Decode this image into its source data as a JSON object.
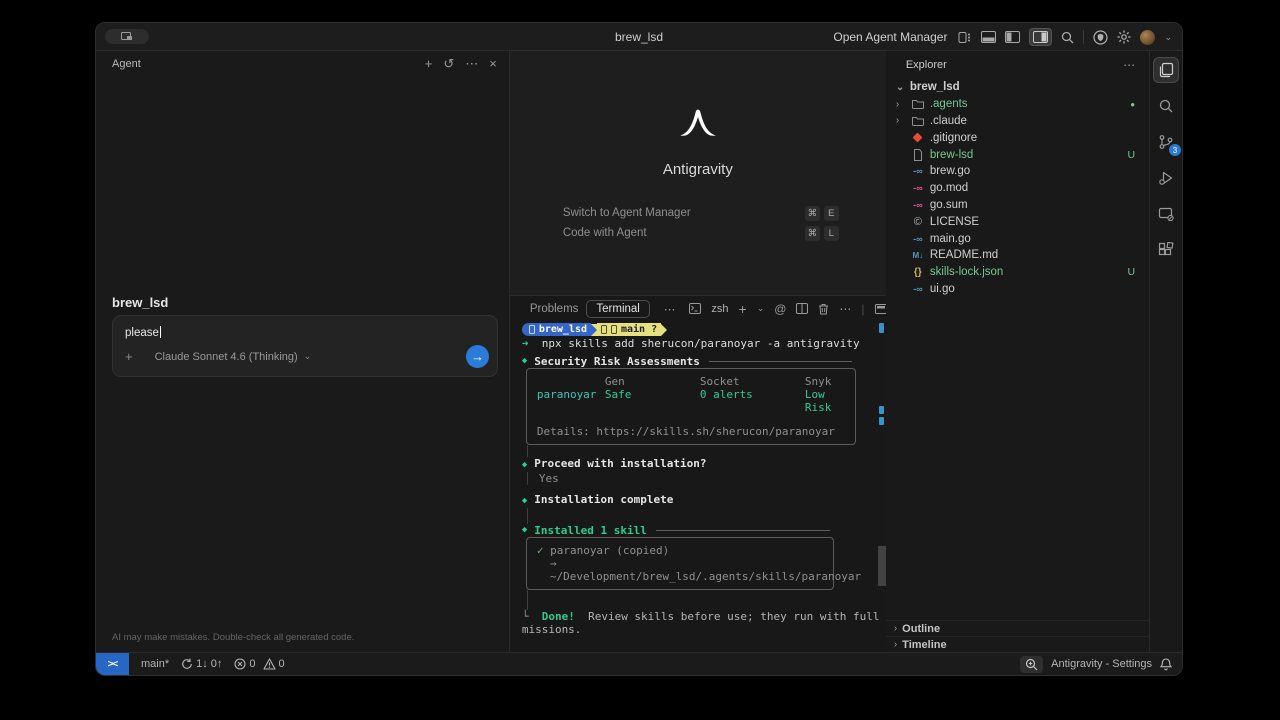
{
  "window": {
    "title": "brew_lsd"
  },
  "titlebar": {
    "agent_manager_label": "Open Agent Manager"
  },
  "agent_panel": {
    "header": "Agent",
    "session_title": "brew_lsd",
    "input_value": "please",
    "model": "Claude Sonnet 4.6 (Thinking)",
    "disclaimer": "AI may make mistakes. Double-check all generated code."
  },
  "welcome": {
    "app_name": "Antigravity",
    "shortcuts": [
      {
        "label": "Switch to Agent Manager",
        "key1": "⌘",
        "key2": "E"
      },
      {
        "label": "Code with Agent",
        "key1": "⌘",
        "key2": "L"
      }
    ]
  },
  "terminal_panel": {
    "tab_problems": "Problems",
    "tab_terminal": "Terminal",
    "shell_label": "zsh"
  },
  "terminal": {
    "prompt_dir": "brew_lsd",
    "prompt_branch": "main ?",
    "arrow": "➜",
    "command": "npx skills add sherucon/paranoyar -a antigravity",
    "risk": {
      "title": "Security Risk Assessments",
      "col1": "Gen",
      "col2": "Socket",
      "col3": "Snyk",
      "name": "paranoyar",
      "val1": "Safe",
      "val2": "0 alerts",
      "val3": "Low Risk",
      "details": "Details: https://skills.sh/sherucon/paranoyar"
    },
    "proceed_title": "Proceed with installation?",
    "proceed_answer": "Yes",
    "complete_title": "Installation complete",
    "installed_title": "Installed 1 skill",
    "installed_check": "✓",
    "installed_item": "paranoyar (copied)",
    "installed_path": "→ ~/Development/brew_lsd/.agents/skills/paranoyar",
    "done_elbow": "└",
    "done_label": "Done!",
    "done_line1": "Review skills before use; they run with full agent per",
    "done_line2": "missions."
  },
  "explorer": {
    "header": "Explorer",
    "root": "brew_lsd",
    "files": [
      {
        "name": ".agents",
        "badge": "●"
      },
      {
        "name": ".claude"
      },
      {
        "name": ".gitignore"
      },
      {
        "name": "brew-lsd",
        "badge": "U"
      },
      {
        "name": "brew.go"
      },
      {
        "name": "go.mod"
      },
      {
        "name": "go.sum"
      },
      {
        "name": "LICENSE"
      },
      {
        "name": "main.go"
      },
      {
        "name": "README.md"
      },
      {
        "name": "skills-lock.json",
        "badge": "U"
      },
      {
        "name": "ui.go"
      }
    ],
    "outline": "Outline",
    "timeline": "Timeline"
  },
  "activity_bar": {
    "scm_badge": "3"
  },
  "status_bar": {
    "branch": "main*",
    "sync": "1↓ 0↑",
    "errors": "0",
    "warnings": "0",
    "settings_label": "Antigravity - Settings"
  },
  "glyphs": {
    "plus": "+",
    "dots": "⋯",
    "close": "×",
    "chevron_down": "⌄",
    "at": "@",
    "pipe": "|",
    "chevron_right": "›",
    "chevron_expanded": "⌄",
    "history": "↺",
    "diamond": "◆",
    "circle": "○",
    "remote": "><",
    "go_icon": "-∞",
    "md_icon": "M↓",
    "json_icon": "{}",
    "license_icon": "©",
    "send_arrow": "→"
  },
  "colors": {
    "accent_blue": "#2b7cd8",
    "git_green": "#73c991",
    "terminal_green": "#2ecc8f",
    "terminal_teal": "#45c5b5",
    "prompt_blue": "#3465c9",
    "prompt_yellow": "#e6e17e",
    "badge_blue": "#2a7ad2",
    "gitignore_red": "#e84d31",
    "go_blue": "#519aba",
    "gomod_pink": "#e44d90"
  }
}
